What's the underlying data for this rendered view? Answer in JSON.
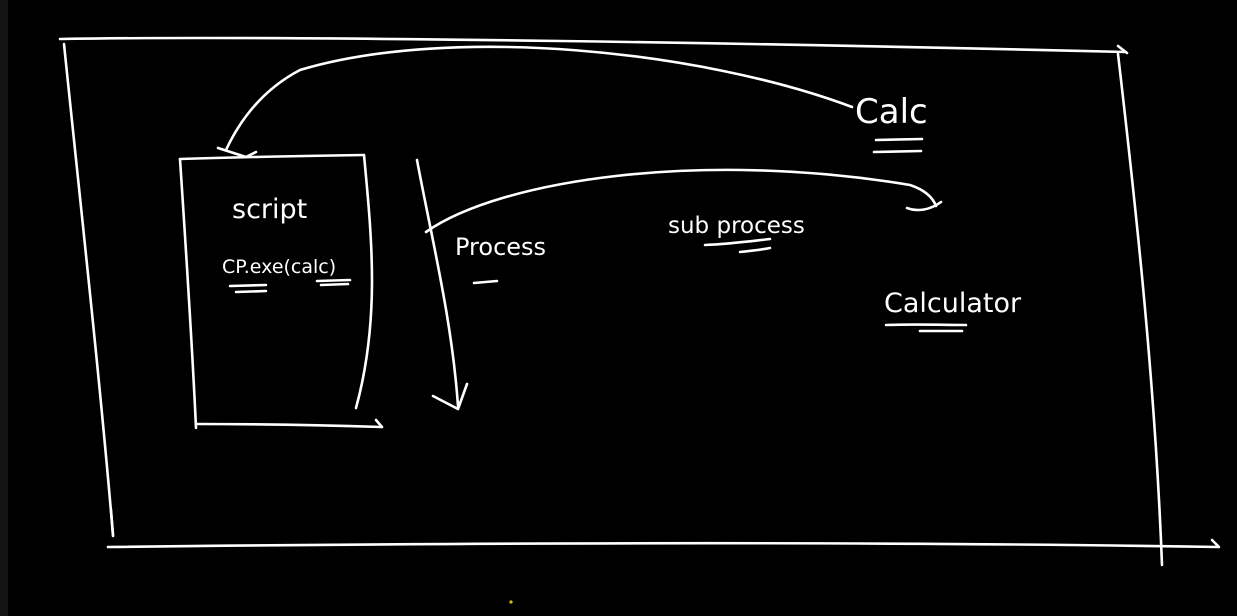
{
  "labels": {
    "script": "script",
    "code": "CP.exe(calc)",
    "process": "Process",
    "subprocess": "sub process",
    "calc": "Calc",
    "calculator": "Calculator"
  },
  "colors": {
    "background": "#000000",
    "ink": "#ffffff",
    "accent_dot": "#d4c21a"
  }
}
